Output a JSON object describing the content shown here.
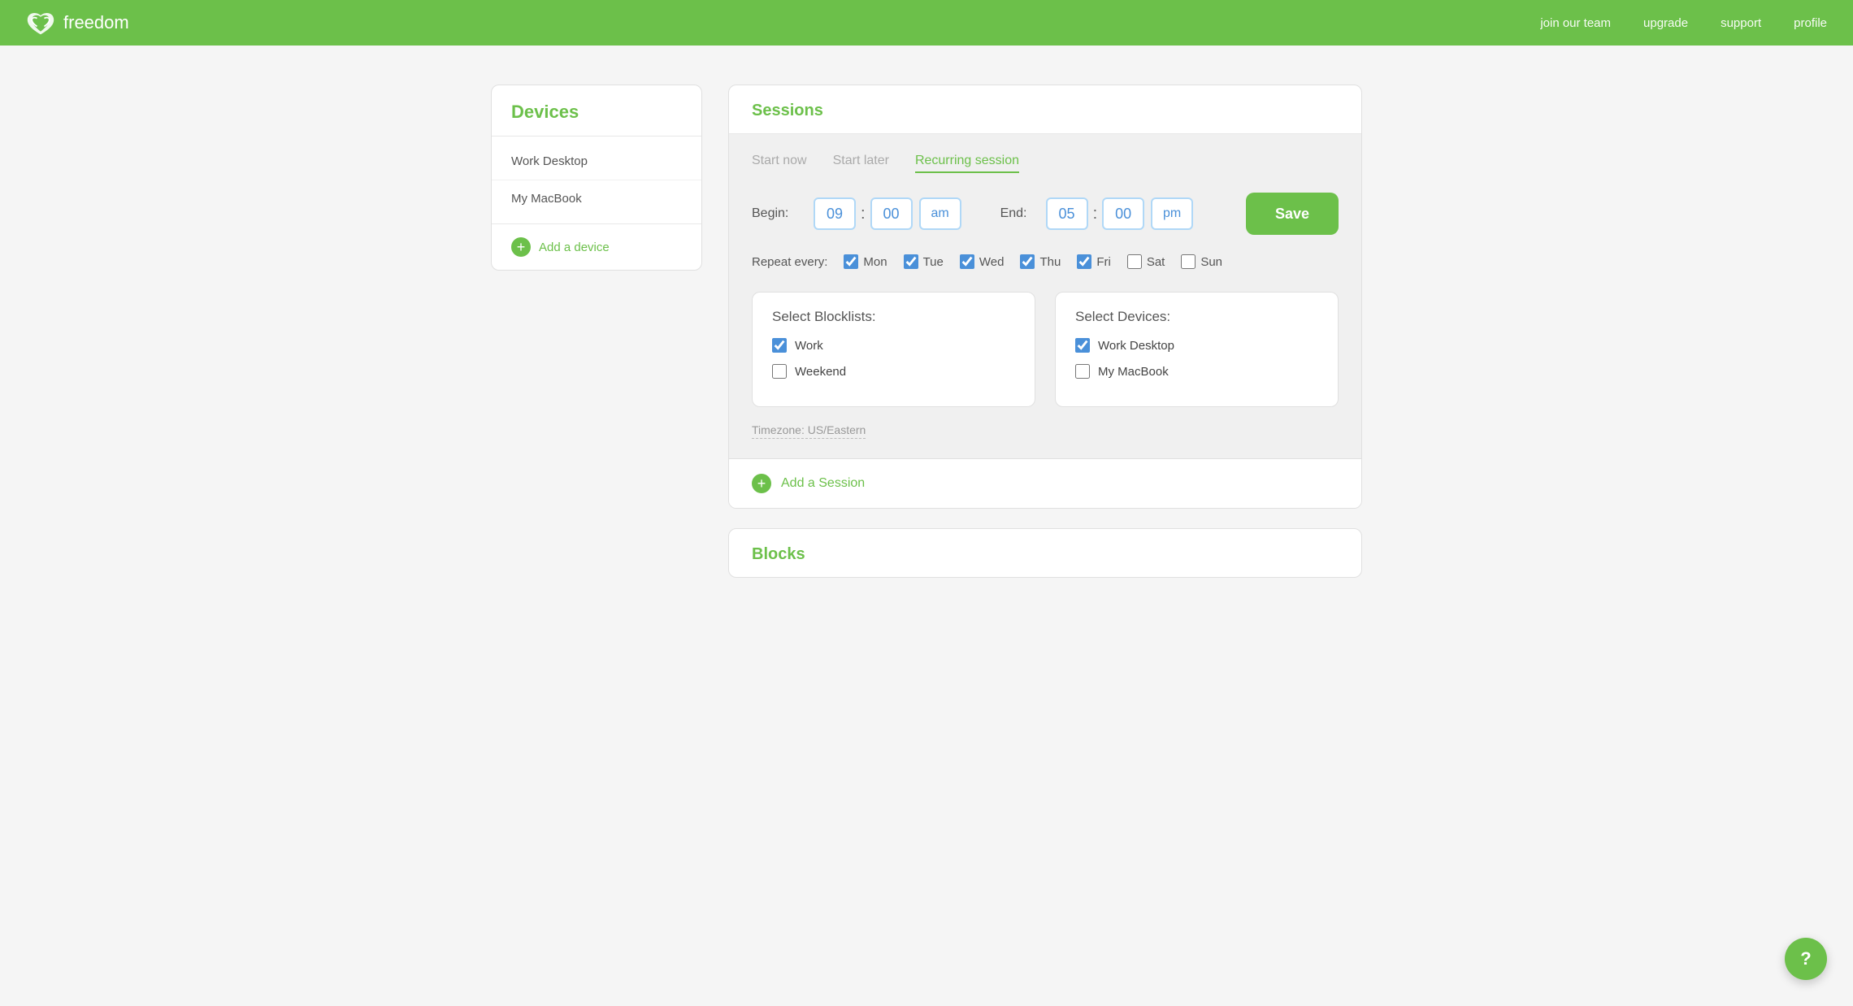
{
  "header": {
    "logo_text": "freedom",
    "nav": {
      "join": "join our team",
      "upgrade": "upgrade",
      "support": "support",
      "profile": "profile"
    }
  },
  "sidebar": {
    "title": "Devices",
    "devices": [
      {
        "label": "Work Desktop"
      },
      {
        "label": "My MacBook"
      }
    ],
    "add_device_label": "Add a device"
  },
  "sessions": {
    "title": "Sessions",
    "tabs": [
      {
        "label": "Start now",
        "active": false
      },
      {
        "label": "Start later",
        "active": false
      },
      {
        "label": "Recurring session",
        "active": true
      }
    ],
    "begin_label": "Begin:",
    "end_label": "End:",
    "begin_hour": "09",
    "begin_minute": "00",
    "begin_ampm": "am",
    "end_hour": "05",
    "end_minute": "00",
    "end_ampm": "pm",
    "save_label": "Save",
    "repeat_label": "Repeat every:",
    "days": [
      {
        "label": "Mon",
        "checked": true
      },
      {
        "label": "Tue",
        "checked": true
      },
      {
        "label": "Wed",
        "checked": true
      },
      {
        "label": "Thu",
        "checked": true
      },
      {
        "label": "Fri",
        "checked": true
      },
      {
        "label": "Sat",
        "checked": false
      },
      {
        "label": "Sun",
        "checked": false
      }
    ],
    "blocklists_title": "Select Blocklists:",
    "blocklists": [
      {
        "label": "Work",
        "checked": true
      },
      {
        "label": "Weekend",
        "checked": false
      }
    ],
    "devices_title": "Select Devices:",
    "devices": [
      {
        "label": "Work Desktop",
        "checked": true
      },
      {
        "label": "My MacBook",
        "checked": false
      }
    ],
    "timezone_label": "Timezone: US/Eastern",
    "add_session_label": "Add a Session"
  },
  "blocks": {
    "title": "Blocks"
  },
  "help": {
    "icon": "?"
  }
}
